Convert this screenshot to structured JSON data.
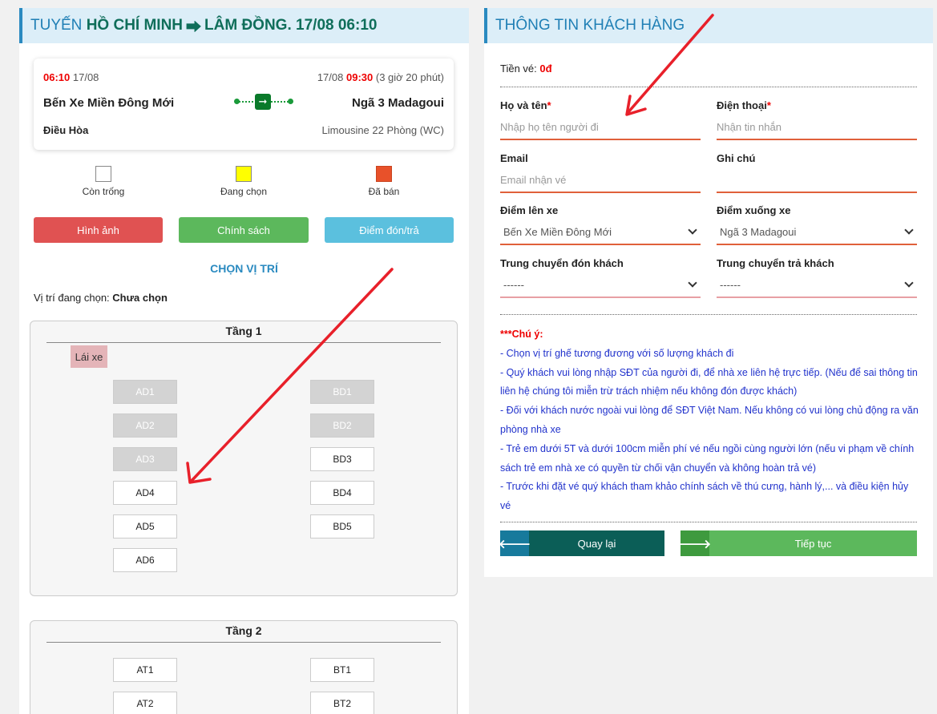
{
  "left": {
    "header": {
      "prefix": "TUYẾN",
      "from": "HỒ CHÍ MINH",
      "sep": "⮕",
      "to": "LÂM ĐỒNG",
      "date_time": ". 17/08 06:10"
    },
    "trip": {
      "depart_time": "06:10",
      "depart_date": "17/08",
      "arrive_date": "17/08",
      "arrive_time": "09:30",
      "duration": "(3 giờ 20 phút)",
      "from_station": "Bến Xe Miền Đông Mới",
      "to_station": "Ngã 3 Madagoui",
      "feature": "Điều Hòa",
      "vehicle": "Limousine 22 Phòng (WC)"
    },
    "legend": [
      {
        "label": "Còn trống",
        "color": "#ffffff"
      },
      {
        "label": "Đang chọn",
        "color": "#ffff00"
      },
      {
        "label": "Đã bán",
        "color": "#e8512a"
      }
    ],
    "buttons": {
      "images": "Hình ảnh",
      "policy": "Chính sách",
      "pickup": "Điểm đón/trả"
    },
    "colors": {
      "images": "#e05252",
      "policy": "#5cb85c",
      "pickup": "#5bc0de"
    },
    "choose_title": "CHỌN VỊ TRÍ",
    "current_label": "Vị trí đang chọn:",
    "current_value": "Chưa chọn",
    "floor1": {
      "title": "Tầng 1",
      "driver": "Lái xe",
      "seats_a": [
        "AD1",
        "AD2",
        "AD3",
        "AD4",
        "AD5",
        "AD6"
      ],
      "seats_b": [
        "BD1",
        "BD2",
        "BD3",
        "BD4",
        "BD5"
      ]
    },
    "floor2": {
      "title": "Tầng 2",
      "seats_a": [
        "AT1",
        "AT2"
      ],
      "seats_b": [
        "BT1",
        "BT2"
      ]
    }
  },
  "right": {
    "header": "THÔNG TIN KHÁCH HÀNG",
    "fare_label": "Tiền vé:",
    "fare_value": "0đ",
    "name": {
      "label": "Họ và tên",
      "req": "*",
      "placeholder": "Nhập họ tên người đi"
    },
    "phone": {
      "label": "Điện thoại",
      "req": "*",
      "placeholder": "Nhận tin nhắn"
    },
    "email": {
      "label": "Email",
      "placeholder": "Email nhận vé"
    },
    "note": {
      "label": "Ghi chú",
      "placeholder": ""
    },
    "pickup": {
      "label": "Điểm lên xe",
      "value": "Bến Xe Miền Đông Mới"
    },
    "dropoff": {
      "label": "Điểm xuống xe",
      "value": "Ngã 3 Madagoui"
    },
    "transfer_pickup": {
      "label": "Trung chuyển đón khách",
      "value": "------"
    },
    "transfer_dropoff": {
      "label": "Trung chuyển trả khách",
      "value": "------"
    },
    "notes": {
      "title": "***Chú ý:",
      "items": [
        "- Chọn vị trí ghế tương đương với số lượng khách đi",
        "- Quý khách vui lòng nhập SĐT của người đi, để nhà xe liên hệ trực tiếp. (Nếu để sai thông tin liên hệ chúng tôi miễn trừ trách nhiệm nếu không đón được khách)",
        "- Đối với khách nước ngoài vui lòng để SĐT Việt Nam. Nếu không có vui lòng chủ động ra văn phòng nhà xe",
        "- Trẻ em dưới 5T và dưới 100cm miễn phí vé nếu ngồi cùng người lớn (nếu vi phạm về chính sách trẻ em nhà xe có quyền từ chối vận chuyển và không hoàn trả vé)",
        "- Trước khi đặt vé quý khách tham khảo chính sách về thú cưng, hành lý,... và điều kiện hủy vé"
      ]
    },
    "back": "Quay lại",
    "next": "Tiếp tục",
    "colors": {
      "back": "#0b5e57",
      "back_icon": "#177a9c",
      "next": "#5cb85c",
      "next_icon": "#3e9a3e"
    }
  }
}
